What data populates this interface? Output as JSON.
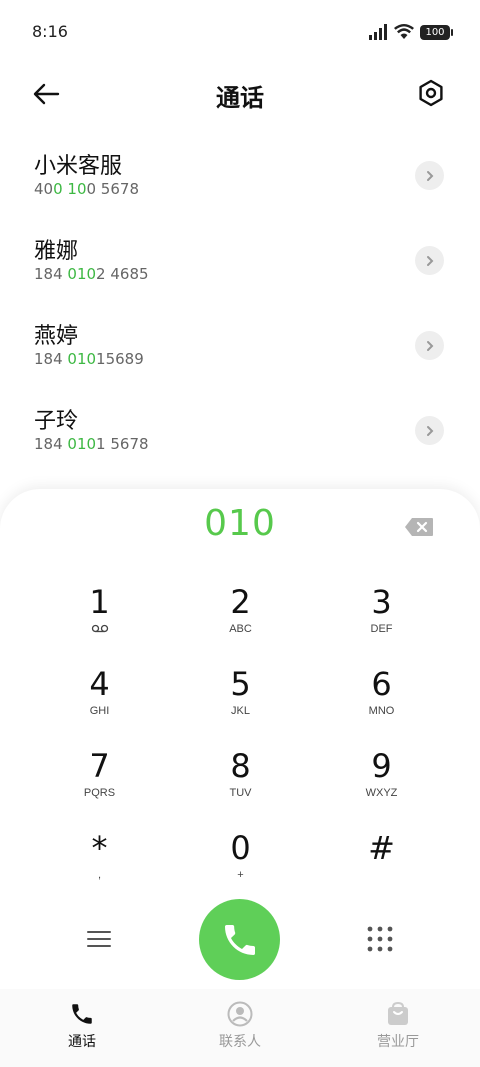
{
  "status_bar": {
    "time": "8:16",
    "battery": "100"
  },
  "header": {
    "title": "通话"
  },
  "contacts": [
    {
      "name": "小米客服",
      "number_parts": [
        "40",
        "0 10",
        "0 5678"
      ]
    },
    {
      "name": "雅娜",
      "number_parts": [
        "184 ",
        "010",
        "2 4685"
      ]
    },
    {
      "name": "燕婷",
      "number_parts": [
        "184 ",
        "010",
        "15689"
      ]
    },
    {
      "name": "子玲",
      "number_parts": [
        "184 ",
        "010",
        "1 5678"
      ]
    }
  ],
  "dialer": {
    "input_value": "010",
    "keys": [
      {
        "digit": "1",
        "letters": ""
      },
      {
        "digit": "2",
        "letters": "ABC"
      },
      {
        "digit": "3",
        "letters": "DEF"
      },
      {
        "digit": "4",
        "letters": "GHI"
      },
      {
        "digit": "5",
        "letters": "JKL"
      },
      {
        "digit": "6",
        "letters": "MNO"
      },
      {
        "digit": "7",
        "letters": "PQRS"
      },
      {
        "digit": "8",
        "letters": "TUV"
      },
      {
        "digit": "9",
        "letters": "WXYZ"
      },
      {
        "digit": "*",
        "letters": ","
      },
      {
        "digit": "0",
        "letters": "+"
      },
      {
        "digit": "#",
        "letters": ""
      }
    ]
  },
  "tabs": [
    {
      "label": "通话",
      "icon": "phone-icon",
      "active": true
    },
    {
      "label": "联系人",
      "icon": "person-icon",
      "active": false
    },
    {
      "label": "营业厅",
      "icon": "bag-icon",
      "active": false
    }
  ],
  "colors": {
    "accent": "#57c94c",
    "call_button": "#5fcf58"
  }
}
